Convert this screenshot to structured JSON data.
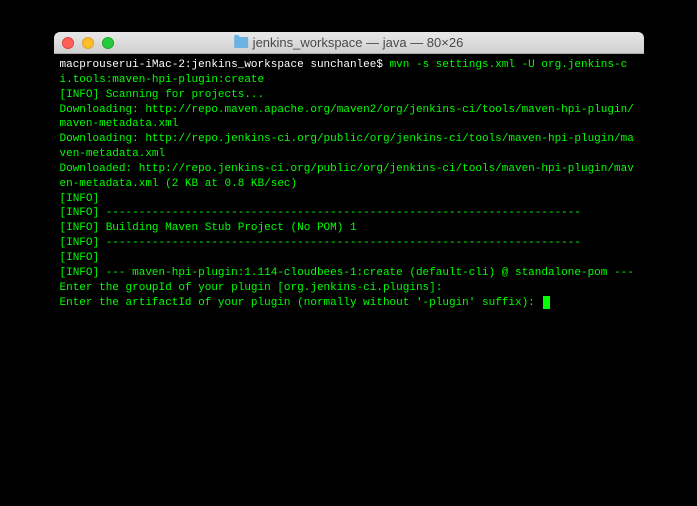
{
  "title_bar": {
    "title": "jenkins_workspace — java — 80×26"
  },
  "terminal": {
    "prompt": "macprouserui-iMac-2:jenkins_workspace sunchanlee$ ",
    "command": "mvn -s settings.xml -U org.jenkins-ci.tools:maven-hpi-plugin:create",
    "lines": {
      "l1": "[INFO] Scanning for projects...",
      "l2": "Downloading: http://repo.maven.apache.org/maven2/org/jenkins-ci/tools/maven-hpi-plugin/maven-metadata.xml",
      "l3": "Downloading: http://repo.jenkins-ci.org/public/org/jenkins-ci/tools/maven-hpi-plugin/maven-metadata.xml",
      "l4": "Downloaded: http://repo.jenkins-ci.org/public/org/jenkins-ci/tools/maven-hpi-plugin/maven-metadata.xml (2 KB at 0.8 KB/sec)",
      "l5": "[INFO]                                                                         ",
      "l6": "[INFO] ------------------------------------------------------------------------",
      "l7": "[INFO] Building Maven Stub Project (No POM) 1",
      "l8": "[INFO] ------------------------------------------------------------------------",
      "l9": "[INFO]",
      "l10": "[INFO] --- maven-hpi-plugin:1.114-cloudbees-1:create (default-cli) @ standalone-pom ---",
      "l11": "Enter the groupId of your plugin [org.jenkins-ci.plugins]:",
      "l12": "Enter the artifactId of your plugin (normally without '-plugin' suffix): "
    }
  }
}
